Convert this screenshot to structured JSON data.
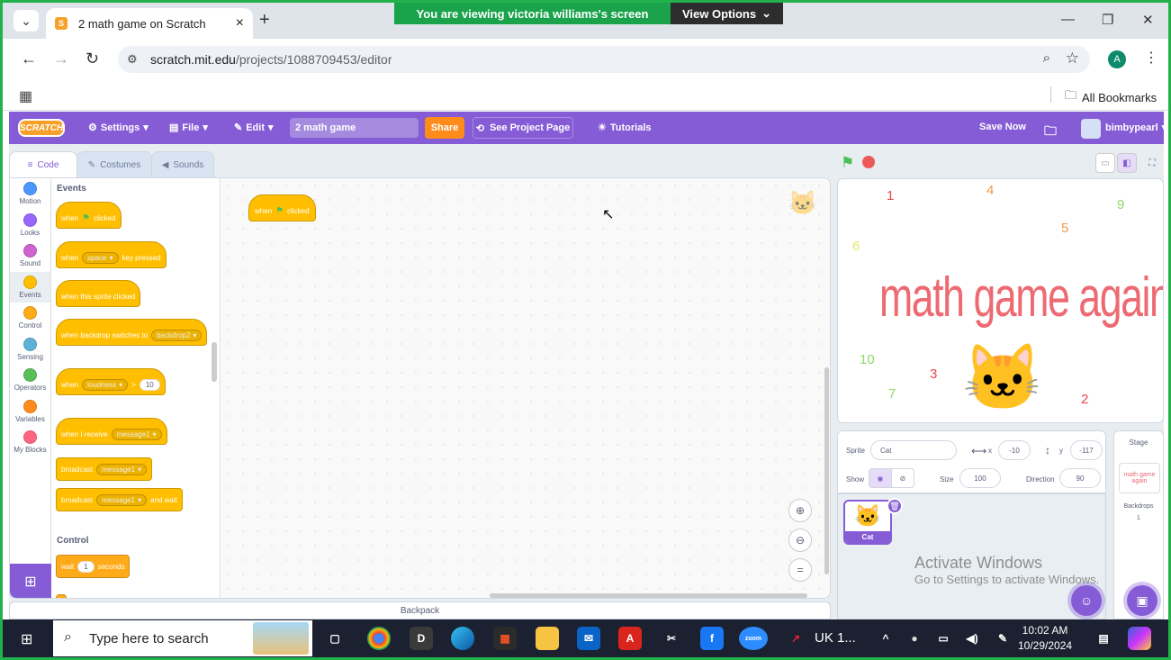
{
  "browser": {
    "tab_title": "2 math game on Scratch",
    "url_host": "scratch.mit.edu",
    "url_path": "/projects/1088709453/editor",
    "profile_initial": "A",
    "all_bookmarks": "All Bookmarks",
    "share_banner": {
      "message": "You are viewing  victoria williams's screen",
      "options": "View Options"
    }
  },
  "menubar": {
    "logo": "SCRATCH",
    "settings": "Settings",
    "file": "File",
    "edit": "Edit",
    "project_title": "2 math game",
    "share": "Share",
    "see_project_page": "See Project Page",
    "tutorials": "Tutorials",
    "save_now": "Save Now",
    "username": "bimbypearl"
  },
  "editor_tabs": [
    "Code",
    "Costumes",
    "Sounds"
  ],
  "categories": [
    {
      "label": "Motion",
      "color": "#4c97ff"
    },
    {
      "label": "Looks",
      "color": "#9966ff"
    },
    {
      "label": "Sound",
      "color": "#cf63cf"
    },
    {
      "label": "Events",
      "color": "#ffbf00"
    },
    {
      "label": "Control",
      "color": "#ffab19"
    },
    {
      "label": "Sensing",
      "color": "#5cb1d6"
    },
    {
      "label": "Operators",
      "color": "#59c059"
    },
    {
      "label": "Variables",
      "color": "#ff8c1a"
    },
    {
      "label": "My Blocks",
      "color": "#ff6680"
    }
  ],
  "palette": {
    "events_title": "Events",
    "control_title": "Control",
    "b1": {
      "a": "when",
      "b": "clicked"
    },
    "b2": {
      "a": "when",
      "key": "space",
      "b": "key pressed"
    },
    "b3": {
      "a": "when this sprite clicked"
    },
    "b4": {
      "a": "when backdrop switches to",
      "drop": "backdrop2"
    },
    "b5": {
      "a": "when",
      "drop": "loudness",
      "op": ">",
      "num": "10"
    },
    "b6": {
      "a": "when I receive",
      "drop": "message1"
    },
    "b7": {
      "a": "broadcast",
      "drop": "message1"
    },
    "b8": {
      "a": "broadcast",
      "drop": "message1",
      "b": "and wait"
    },
    "b9": {
      "a": "wait",
      "num": "1",
      "b": "seconds"
    }
  },
  "workspace": {
    "script": {
      "a": "when",
      "b": "clicked"
    }
  },
  "backpack": "Backpack",
  "stage": {
    "title": "math game again",
    "numbers": [
      "1",
      "4",
      "9",
      "5",
      "6",
      "10",
      "3",
      "6",
      "7",
      "2"
    ]
  },
  "sprite_info": {
    "sprite_label": "Sprite",
    "sprite_name": "Cat",
    "x_label": "x",
    "x": "-10",
    "y_label": "y",
    "y": "-117",
    "show_label": "Show",
    "size_label": "Size",
    "size": "100",
    "direction_label": "Direction",
    "direction": "90"
  },
  "sprite_tile": "Cat",
  "stage_pane": {
    "title": "Stage",
    "thumb_text": "math game again",
    "backdrops_label": "Backdrops",
    "backdrops_count": "1"
  },
  "watermark": {
    "line1": "Activate Windows",
    "line2": "Go to Settings to activate Windows."
  },
  "taskbar": {
    "search_placeholder": "Type here to search",
    "app_label": "UK 1...",
    "time": "10:02 AM",
    "date": "10/29/2024",
    "d_letter": "D",
    "zoom_label": "zoom"
  }
}
